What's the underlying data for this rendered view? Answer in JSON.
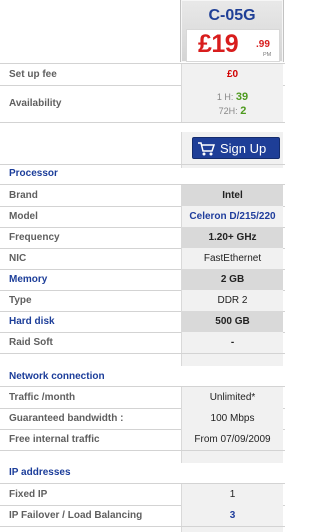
{
  "plan": {
    "name": "C-05G",
    "price_main": "£19",
    "price_pence": ".99",
    "price_period": "PM"
  },
  "setup": {
    "label": "Set up fee",
    "value": "£0"
  },
  "availability": {
    "label": "Availability",
    "line1_prefix": "1 H: ",
    "line1_value": "39",
    "line2_prefix": "72H: ",
    "line2_value": "2"
  },
  "signup": {
    "label": "Sign Up",
    "icon": "shopping-cart-icon"
  },
  "processor": {
    "section": "Processor",
    "rows": [
      {
        "label": "Brand",
        "value": "Intel"
      },
      {
        "label": "Model",
        "value": "Celeron D/215/220"
      },
      {
        "label": "Frequency",
        "value": "1.20+ GHz"
      },
      {
        "label": "NIC",
        "value": "FastEthernet"
      },
      {
        "label": "Memory",
        "value": "2 GB"
      },
      {
        "label": "Type",
        "value": "DDR 2"
      },
      {
        "label": "Hard disk",
        "value": "500 GB"
      },
      {
        "label": "Raid Soft",
        "value": "-"
      }
    ]
  },
  "network": {
    "section": "Network connection",
    "rows": [
      {
        "label": "Traffic /month",
        "value": "Unlimited*"
      },
      {
        "label": "Guaranteed bandwidth :",
        "value": "100 Mbps"
      },
      {
        "label": "Free internal traffic",
        "value": "From 07/09/2009"
      }
    ]
  },
  "ip": {
    "section": "IP addresses",
    "rows": [
      {
        "label": "Fixed IP",
        "value": "1"
      },
      {
        "label": "IP Failover / Load Balancing",
        "value": "3"
      }
    ]
  }
}
